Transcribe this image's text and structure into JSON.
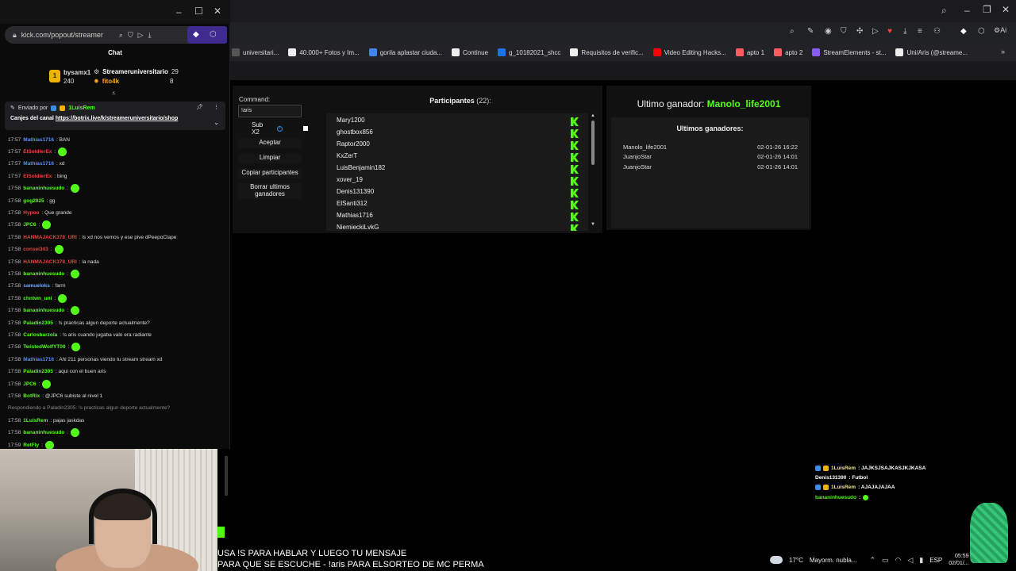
{
  "chat_window": {
    "url": "kick.com/popout/streamer",
    "header": "Chat",
    "leaderboard": [
      {
        "rank": "1",
        "name": "bysamx1",
        "value": "240"
      },
      {
        "name": "Streameruniversitario",
        "value": "29"
      },
      {
        "name": "fito4k",
        "value": "8"
      }
    ],
    "pinned": {
      "sent_by": "Enviado por",
      "user": "1LuisRem",
      "text_prefix": "Canjes del canal",
      "link": "https://botrix.live/k/streameruniversitario/shop"
    },
    "messages": [
      {
        "ts": "17:57",
        "user": "Mathias1716",
        "color": "#5a8dff",
        "text": ": BAN"
      },
      {
        "ts": "17:57",
        "user": "ElSoldierEx",
        "color": "#e0443e",
        "text": ":",
        "emote": true
      },
      {
        "ts": "17:57",
        "user": "Mathias1716",
        "color": "#5a8dff",
        "text": ": xd"
      },
      {
        "ts": "17:57",
        "user": "ElSoldierEx",
        "color": "#e0443e",
        "text": ": bing"
      },
      {
        "ts": "17:58",
        "user": "bananinhuesudo",
        "color": "#53fc18",
        "text": ":",
        "emote": true
      },
      {
        "ts": "17:58",
        "user": "gog2025",
        "color": "#53fc18",
        "text": ": gg"
      },
      {
        "ts": "17:58",
        "user": "Hypoo",
        "color": "#e0443e",
        "text": ": Que grande"
      },
      {
        "ts": "17:58",
        "user": "JPC6",
        "color": "#53fc18",
        "text": ":",
        "emote": true
      },
      {
        "ts": "17:58",
        "user": "HANMAJACK378_URI",
        "color": "#e0443e",
        "text": ": ls xd nos vemos y ese pive dPeepoClape"
      },
      {
        "ts": "17:58",
        "user": "consei343",
        "color": "#e0443e",
        "text": ":",
        "emote": true
      },
      {
        "ts": "17:58",
        "user": "HANMAJACK378_URI",
        "color": "#e0443e",
        "text": ": la nada"
      },
      {
        "ts": "17:58",
        "user": "bananinhuesudo",
        "color": "#53fc18",
        "text": ":",
        "emote": true
      },
      {
        "ts": "17:58",
        "user": "samueloks",
        "color": "#6ea8ff",
        "text": ": farm"
      },
      {
        "ts": "17:58",
        "user": "chntwn_uni",
        "color": "#53fc18",
        "text": ":",
        "emote": true
      },
      {
        "ts": "17:58",
        "user": "bananinhuesudo",
        "color": "#53fc18",
        "text": ":",
        "emote": true
      },
      {
        "ts": "17:58",
        "user": "Paladin2305",
        "color": "#53fc18",
        "text": ": !s practicas algun deporte actualmente?"
      },
      {
        "ts": "17:58",
        "user": "Carlosbarzola",
        "color": "#53fc18",
        "text": ": !s aris cuando jugaba valo era radiante"
      },
      {
        "ts": "17:58",
        "user": "TwistedWolfYT00",
        "color": "#53fc18",
        "text": ":",
        "emote": true
      },
      {
        "ts": "17:58",
        "user": "Mathias1716",
        "color": "#5a8dff",
        "text": ": Ahi 211 personas viendo tu stream stream xd"
      },
      {
        "ts": "17:58",
        "user": "Paladin2305",
        "color": "#53fc18",
        "text": ": aqui con el buen aris"
      },
      {
        "ts": "17:58",
        "user": "JPC6",
        "color": "#53fc18",
        "text": ":",
        "emote": true
      },
      {
        "ts": "17:58",
        "user": "BotRix",
        "color": "#53fc18",
        "text": ": @JPC6 subiste al nivel 1"
      },
      {
        "ts": "",
        "user": "",
        "color": "#888",
        "text": "Respondiendo a Paladin2305: !s practicas algun deporte actualmente?"
      },
      {
        "ts": "17:58",
        "user": "1LuisRem",
        "color": "#53fc18",
        "text": ": pajas jaskdas"
      },
      {
        "ts": "17:58",
        "user": "bananinhuesudo",
        "color": "#53fc18",
        "text": ":",
        "emote": true
      },
      {
        "ts": "17:59",
        "user": "RetFly",
        "color": "#53fc18",
        "text": ":",
        "emote": true
      }
    ]
  },
  "bookmarks": [
    {
      "label": "universitari...",
      "color": "#555"
    },
    {
      "label": "40.000+ Fotos y Im...",
      "color": "#eee"
    },
    {
      "label": "gorila aplastar ciuda...",
      "color": "#4285f4"
    },
    {
      "label": "Continue",
      "color": "#eee"
    },
    {
      "label": "g_10182021_shcc",
      "color": "#1a73e8"
    },
    {
      "label": "Requisitos de verific...",
      "color": "#eee"
    },
    {
      "label": "Video Editing Hacks...",
      "color": "#ff0000"
    },
    {
      "label": "apto 1",
      "color": "#ff5a5f"
    },
    {
      "label": "apto 2",
      "color": "#ff5a5f"
    },
    {
      "label": "StreamElements - st...",
      "color": "#8a5cf6"
    },
    {
      "label": "Uni/Aris (@streame...",
      "color": "#eee"
    }
  ],
  "tool": {
    "command_label": "Command:",
    "command_value": "!aris",
    "sub_label": "Sub X2",
    "buttons": [
      "Aceptar",
      "Limpiar",
      "Copiar participantes",
      "Borrar ultimos ganadores"
    ],
    "participants_title": "Participantes",
    "participants_count": "(22):",
    "participants": [
      "Mary1200",
      "ghostbox856",
      "Raptor2000",
      "KxZerT",
      "LuisBenjamin182",
      "xover_19",
      "Denis131390",
      "ElSanti312",
      "Mathias1716",
      "NiemieckiLvkG"
    ],
    "winner_label": "Ultimo ganador:",
    "winner_name": "Manolo_life2001",
    "recent_title": "Ultimos ganadores:",
    "recent": [
      {
        "name": "Manolo_life2001",
        "date": "02-01-26 16:22"
      },
      {
        "name": "JuanjoStar",
        "date": "02-01-26 14:01"
      },
      {
        "name": "JuanjoStar",
        "date": "02-01-26 14:01"
      }
    ]
  },
  "overlay_chat": [
    {
      "user": "1LuisRem",
      "text": ": JAJKSJSAJKASJKJKASA"
    },
    {
      "user": "Denis131390",
      "text": ": Futbol"
    },
    {
      "user": "1LuisRem",
      "text": ": AJAJAJAJAA"
    },
    {
      "user": "bananinhuesudo",
      "text": ":"
    }
  ],
  "subtitles": {
    "line1": "USA !S PARA HABLAR Y LUEGO TU MENSAJE",
    "line2": "PARA QUE SE ESCUCHE - !aris PARA ELSORTEO DE MC PERMA"
  },
  "taskbar": {
    "temp": "17°C",
    "weather": "Mayorm. nubla...",
    "lang": "ESP",
    "time": "05:59",
    "date": "02/01/..."
  },
  "icons": [
    "search-icon",
    "shield-icon",
    "download-icon",
    "close-icon",
    "minimize-icon",
    "maximize-icon",
    "star-icon",
    "k-logo-icon"
  ],
  "colors": {
    "kick_green": "#53fc18",
    "bg": "#000000",
    "panel": "#111111"
  }
}
